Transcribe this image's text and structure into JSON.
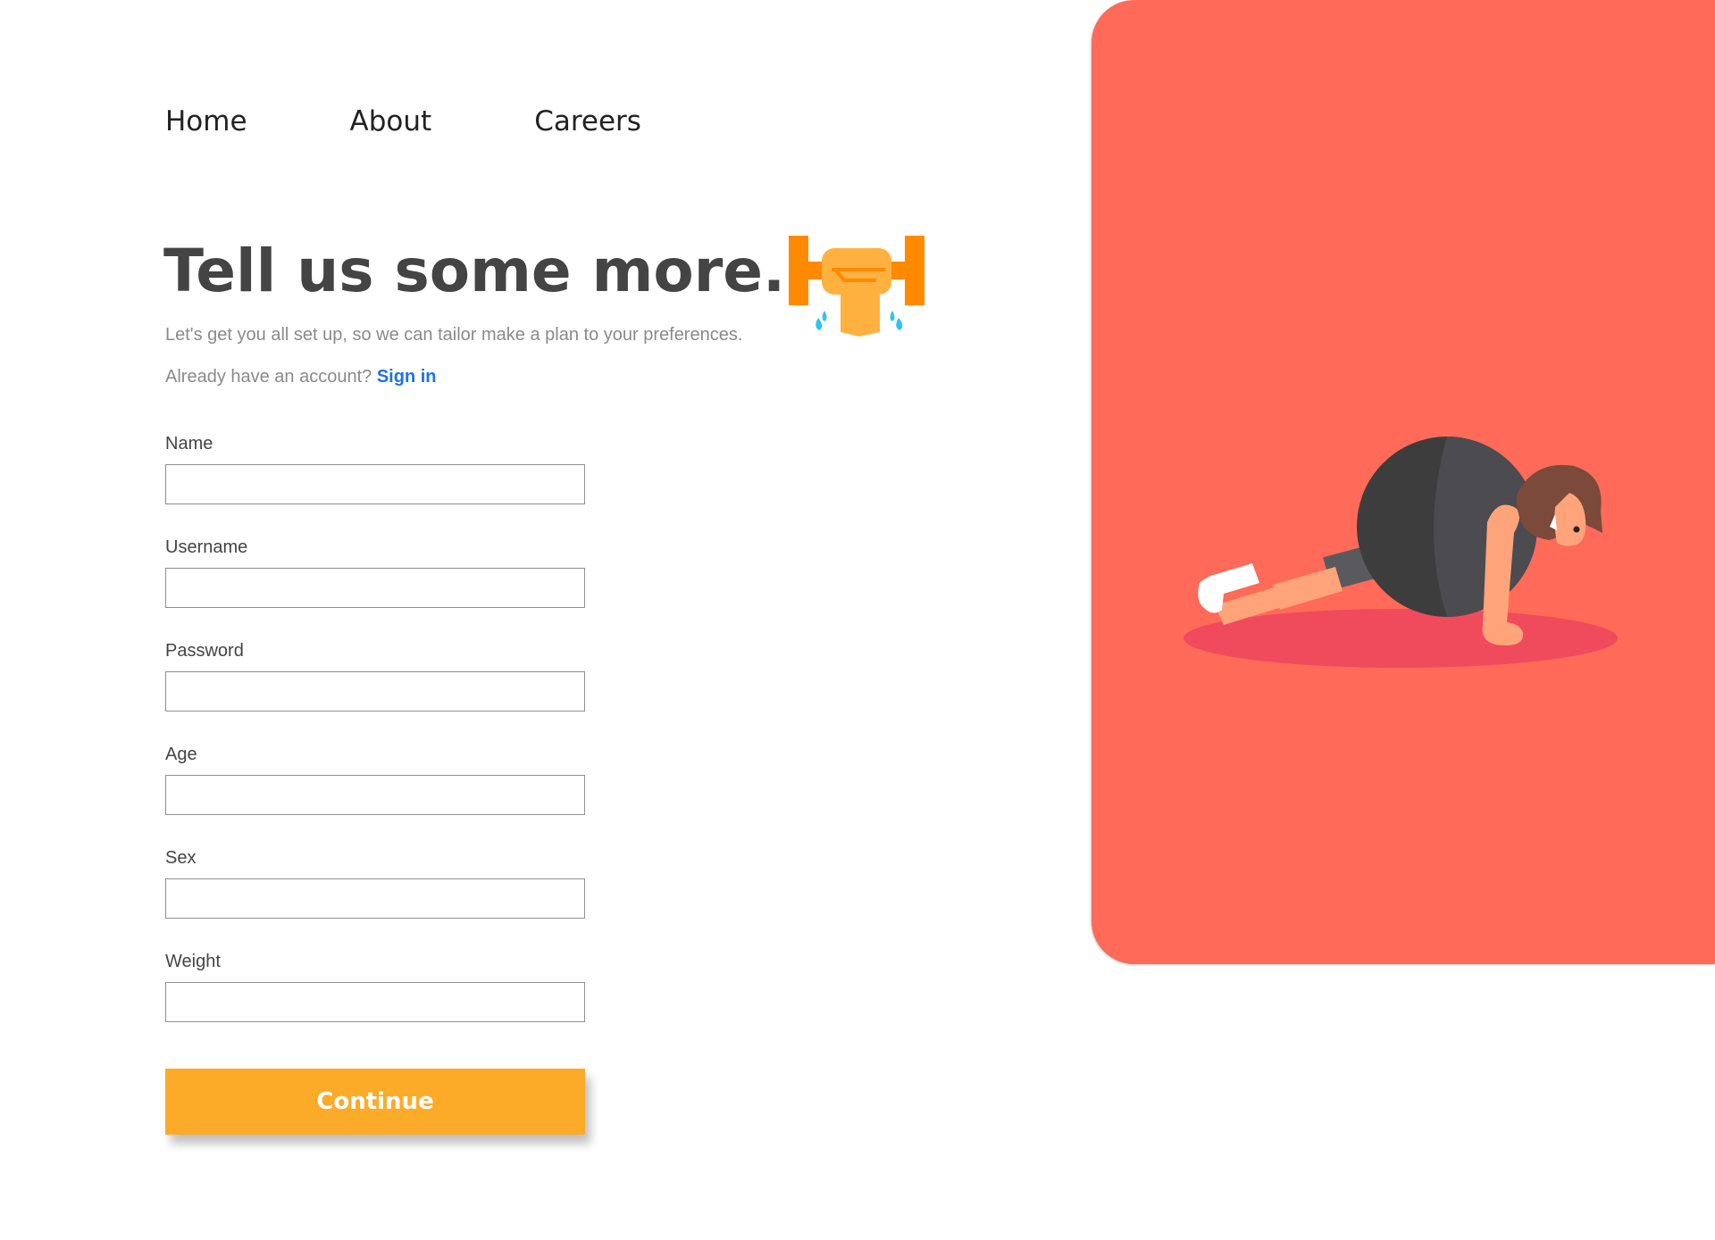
{
  "nav": {
    "items": [
      {
        "label": "Home"
      },
      {
        "label": "About"
      },
      {
        "label": "Careers"
      }
    ]
  },
  "hero": {
    "title": "Tell us some more..",
    "subtitle": "Let's get you all set up, so we can tailor make a plan to your preferences.",
    "account_prompt": "Already have an account?",
    "signin_label": "Sign in",
    "icon": "dumbbell-icon"
  },
  "form": {
    "fields": [
      {
        "label": "Name",
        "value": ""
      },
      {
        "label": "Username",
        "value": ""
      },
      {
        "label": "Password",
        "value": ""
      },
      {
        "label": "Age",
        "value": ""
      },
      {
        "label": "Sex",
        "value": ""
      },
      {
        "label": "Weight",
        "value": ""
      }
    ],
    "submit_label": "Continue"
  },
  "panel": {
    "illustration": "person-exercise-ball-illustration"
  },
  "colors": {
    "accent": "#fcab28",
    "panel": "#ff6a59",
    "link": "#1a73e8"
  }
}
